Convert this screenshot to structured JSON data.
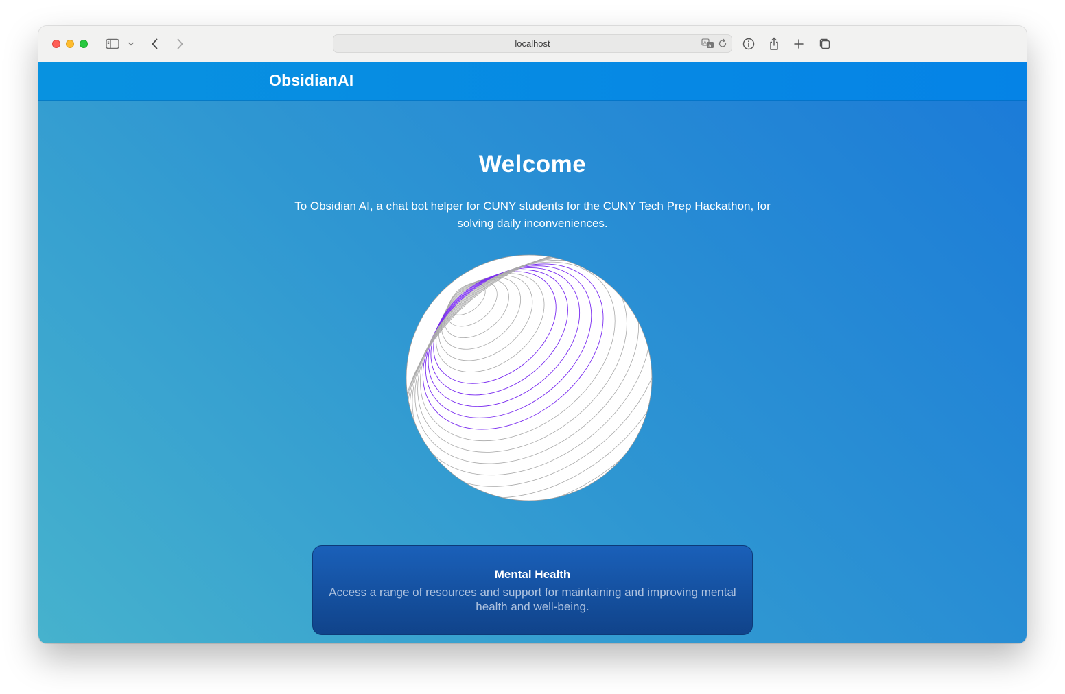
{
  "browser": {
    "url": "localhost"
  },
  "site": {
    "brand": "ObsidianAI"
  },
  "hero": {
    "title": "Welcome",
    "subtitle": "To Obsidian AI, a chat bot helper for CUNY students for the CUNY Tech Prep Hackathon, for solving daily inconveniences."
  },
  "card": {
    "title": "Mental Health",
    "description": "Access a range of resources and support for maintaining and improving mental health and well-being."
  },
  "colors": {
    "gradient_start": "#46b2cd",
    "gradient_end": "#1b7ad8",
    "nav": "#0583e6",
    "card": "#10438a",
    "sphere_highlight": "#7a2cf0"
  },
  "icons": {
    "sidebar": "sidebar-icon",
    "back": "chevron-left-icon",
    "forward": "chevron-right-icon",
    "translate": "translate-icon",
    "reload": "reload-icon",
    "info": "info-icon",
    "share": "share-icon",
    "new_tab": "plus-icon",
    "tabs": "tabs-overview-icon"
  }
}
